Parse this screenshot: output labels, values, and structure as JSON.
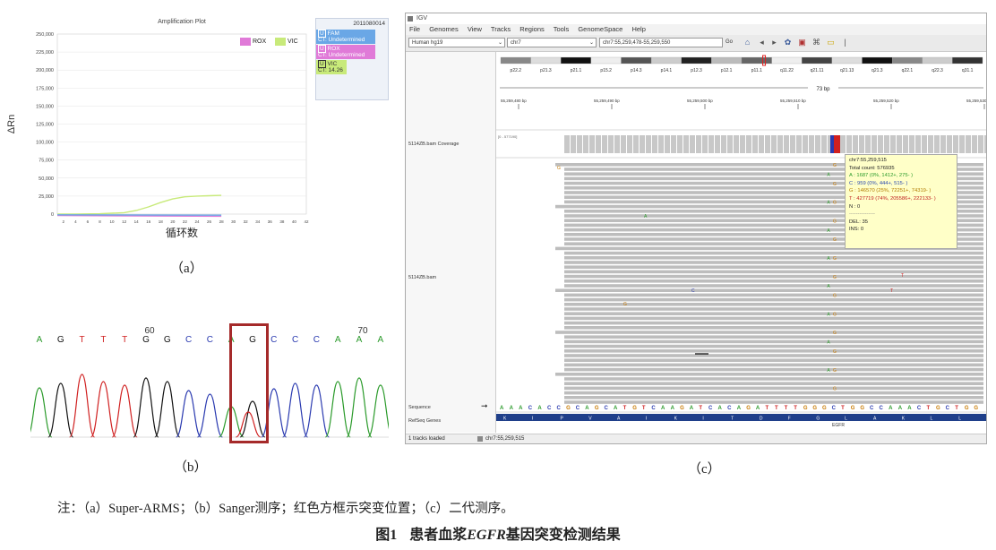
{
  "panel_a": {
    "title": "Amplification Plot",
    "ylabel": "ΔRn",
    "xlabel": "循环数",
    "y_ticks": [
      "250,000",
      "225,000",
      "200,000",
      "175,000",
      "150,000",
      "125,000",
      "100,000",
      "75,000",
      "50,000",
      "25,000",
      "0"
    ],
    "x_ticks": [
      "2",
      "4",
      "6",
      "8",
      "10",
      "12",
      "14",
      "16",
      "18",
      "20",
      "22",
      "24",
      "26",
      "28",
      "30",
      "32",
      "34",
      "36",
      "38",
      "40",
      "42"
    ],
    "legend": [
      {
        "label": "ROX",
        "color": "#e07ad8"
      },
      {
        "label": "VIC",
        "color": "#c8ea7a"
      }
    ],
    "well_box": {
      "id": "2011080014",
      "entries": [
        {
          "tag": "U",
          "name": "FAM",
          "ct": "CT: Undetermined",
          "color": "#6aa7e6"
        },
        {
          "tag": "U",
          "name": "ROX",
          "ct": "CT: Undetermined",
          "color": "#e07ad8"
        },
        {
          "tag": "U",
          "name": "VIC",
          "ct": "CT: 14.26",
          "color": "#c8ea7a"
        }
      ]
    },
    "caption": "（a）",
    "chart_data": {
      "type": "line",
      "title": "Amplification Plot",
      "xlabel": "循环数",
      "ylabel": "ΔRn",
      "ylim": [
        0,
        250000
      ],
      "xlim": [
        1,
        42
      ],
      "series": [
        {
          "name": "VIC",
          "color": "#c8ea7a",
          "x": [
            1,
            4,
            8,
            12,
            14,
            16,
            18,
            20,
            22,
            24,
            26,
            28
          ],
          "y": [
            0,
            0,
            500,
            2000,
            5000,
            10000,
            16000,
            21000,
            24000,
            25000,
            25500,
            26000
          ]
        },
        {
          "name": "ROX",
          "color": "#e07ad8",
          "x": [
            1,
            28
          ],
          "y": [
            -2000,
            -3000
          ]
        },
        {
          "name": "FAM",
          "color": "#6aa7e6",
          "x": [
            1,
            28
          ],
          "y": [
            -1000,
            -1500
          ]
        }
      ]
    }
  },
  "panel_b": {
    "bases": [
      "A",
      "G",
      "T",
      "T",
      "T",
      "G",
      "G",
      "C",
      "C",
      "A",
      "G",
      "C",
      "C",
      "C",
      "A",
      "A",
      "A"
    ],
    "position_labels": [
      {
        "text": "60",
        "index": 5
      },
      {
        "text": "70",
        "index": 15
      }
    ],
    "caption": "（b）"
  },
  "panel_c": {
    "window_title": "IGV",
    "menu": [
      "File",
      "Genomes",
      "View",
      "Tracks",
      "Regions",
      "Tools",
      "GenomeSpace",
      "Help"
    ],
    "genome": "Human hg19",
    "chromosome": "chr7",
    "locus": "chr7:55,259,478-55,259,550",
    "go": "Go",
    "cytobands": [
      "p22.2",
      "p21.3",
      "p21.1",
      "p15.2",
      "p14.3",
      "p14.1",
      "p12.3",
      "p12.1",
      "p11.1",
      "q11.22",
      "q21.11",
      "q21.13",
      "q21.3",
      "q22.1",
      "q22.3",
      "q31.1"
    ],
    "span": "73 bp",
    "ruler": [
      "55,259,480 bp",
      "55,259,490 bp",
      "55,259,500 bp",
      "55,259,510 bp",
      "55,259,520 bp",
      "55,259,530 bp"
    ],
    "coverage_track": "5114ZB.bam Coverage",
    "coverage_range": "[0 - 577190]",
    "bam_track": "5114ZB.bam",
    "sequence_track": "Sequence",
    "refseq_track": "RefSeq Genes",
    "status_left": "1 tracks loaded",
    "status_locus": "chr7:55,259,515",
    "gene": "EGFR",
    "tooltip": [
      "chr7:55,259,515",
      "Total count: 576935",
      "A : 1687 (0%, 1412+, 275- )",
      "C : 959 (0%, 444+, 515- )",
      "G : 146570 (25%, 72251+, 74319- )",
      "T : 427719 (74%, 205586+, 222133- )",
      "N : 0",
      "---------------",
      "DEL: 35",
      "INS: 0"
    ],
    "sequence": "AAACACCGCAGCATGTCAAGATCACAGATTTTGGGCTGGCCAAACTGCTGG",
    "amino_acids": [
      "K",
      "I",
      "P",
      "V",
      "A",
      "I",
      "K",
      "I",
      "T",
      "D",
      "F",
      "G",
      "L",
      "A",
      "K",
      "L",
      "L"
    ],
    "caption": "（c）"
  },
  "note": "注：（a）Super-ARMS；（b）Sanger测序；红色方框示突变位置；（c）二代测序。",
  "figure_caption": {
    "prefix": "图1",
    "text_a": "患者血浆",
    "gene": "EGFR",
    "text_b": "基因突变检测结果"
  }
}
